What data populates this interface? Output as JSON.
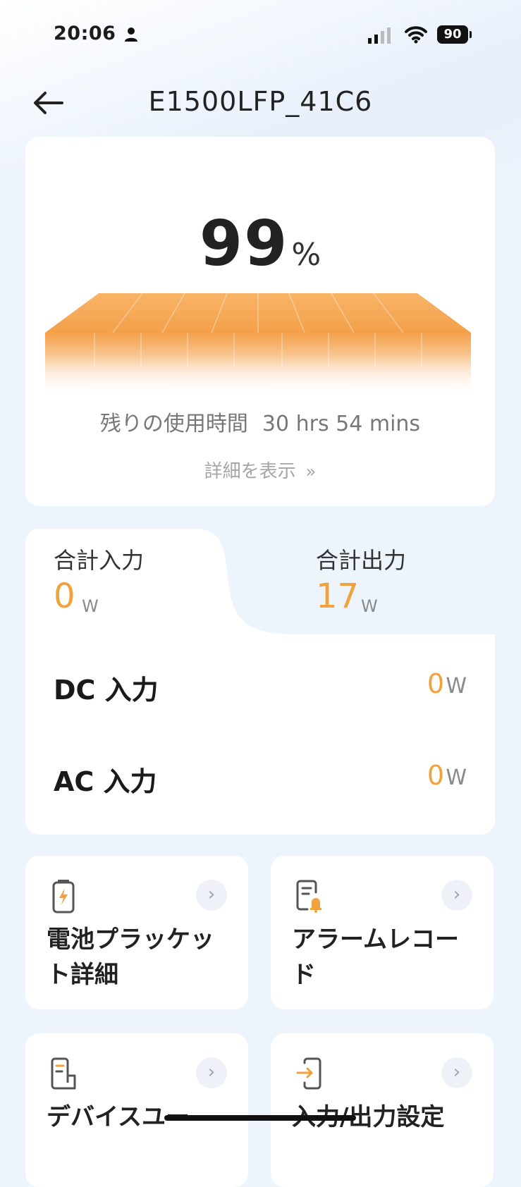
{
  "status_bar": {
    "time": "20:06",
    "battery_level": "90",
    "icons": [
      "person-icon",
      "signal-icon",
      "wifi-icon",
      "battery-icon"
    ]
  },
  "header": {
    "title": "E1500LFP_41C6",
    "back_icon": "back-arrow-icon"
  },
  "battery_card": {
    "percent_value": "99",
    "percent_sign": "%",
    "charge_fraction": 0.99,
    "accent_color": "#f5a44a",
    "remaining_label": "残りの使用時間",
    "remaining_value": "30 hrs 54 mins",
    "details_link": "詳細を表示",
    "details_chevron": "»"
  },
  "power": {
    "total_input": {
      "label": "合計入力",
      "value": "0",
      "unit": "W"
    },
    "total_output": {
      "label": "合計出力",
      "value": "17",
      "unit": "W"
    },
    "rows": [
      {
        "label": "DC 入力",
        "value": "0",
        "unit": "W"
      },
      {
        "label": "AC 入力",
        "value": "0",
        "unit": "W"
      }
    ],
    "value_color": "#f0a23c"
  },
  "tiles": [
    {
      "label": "電池プラッケット詳細",
      "icon": "battery-icon",
      "chevron": "›"
    },
    {
      "label": "アラームレコード",
      "icon": "alarm-record-icon",
      "chevron": "›"
    },
    {
      "label": "デバイスユー",
      "icon": "device-icon",
      "chevron": "›"
    },
    {
      "label": "入力/出力設定",
      "icon": "io-settings-icon",
      "chevron": "›"
    }
  ]
}
